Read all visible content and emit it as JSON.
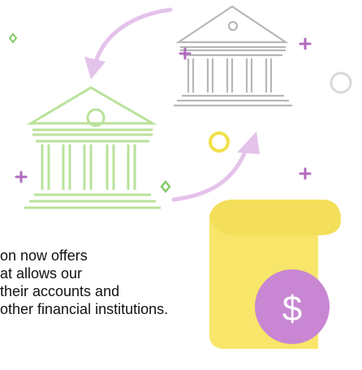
{
  "caption": {
    "lines": [
      "on now offers",
      "at allows our",
      "their accounts and",
      "other financial institutions."
    ]
  },
  "illustration": {
    "currency_symbol": "$",
    "icons": [
      "bank-building-icon",
      "bank-building-outline-icon",
      "curved-arrow-icon",
      "sticky-note-icon",
      "dollar-coin-icon",
      "plus-sparkle-icon",
      "diamond-sparkle-icon",
      "circle-sparkle-icon"
    ],
    "colors": {
      "bank_green": "#b9e29a",
      "bank_gray": "#b7b7b7",
      "arrow_purple": "#e4c3ea",
      "note_yellow": "#f7e66a",
      "note_yellow_dark": "#f1d94a",
      "coin_purple": "#c886d3",
      "plus_purple": "#b06bbf",
      "diamond_green": "#86c96a",
      "ring_yellow": "#f1e04a",
      "ring_gray": "#d9d9d9"
    }
  }
}
